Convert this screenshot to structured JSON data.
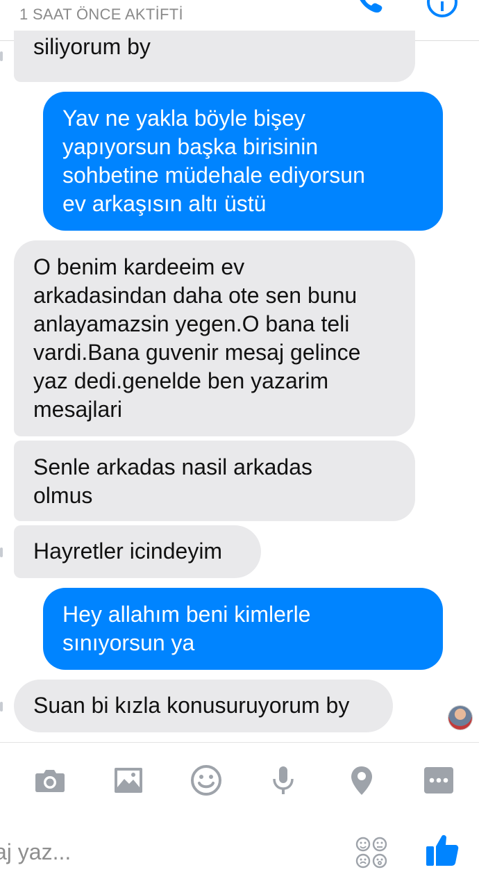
{
  "header": {
    "status": "1 SAAT ÖNCE AKTİFTİ",
    "icons": [
      "phone-icon",
      "info-icon"
    ]
  },
  "colors": {
    "outgoing": "#0084ff",
    "incoming": "#e9e9eb",
    "icon_gray": "#9ea3aa",
    "like_blue": "#0084ff"
  },
  "messages": [
    {
      "direction": "in",
      "lines": [
        "siliyorum by"
      ]
    },
    {
      "direction": "out",
      "lines": [
        "Yav ne yakla böyle bişey",
        "yapıyorsun başka birisinin",
        "sohbetine müdehale ediyorsun",
        "ev arkaşısın altı üstü"
      ]
    },
    {
      "direction": "in",
      "lines": [
        "O benim kardeeim ev",
        "arkadasindan daha ote sen bunu",
        "anlayamazsin yegen.O bana teli",
        "vardi.Bana guvenir mesaj gelince",
        "yaz dedi.genelde ben yazarim",
        "mesajlari"
      ]
    },
    {
      "direction": "in",
      "lines": [
        "Senle arkadas nasil arkadas",
        "olmus"
      ]
    },
    {
      "direction": "in",
      "lines": [
        "Hayretler icindeyim"
      ]
    },
    {
      "direction": "out",
      "lines": [
        "Hey allahım beni kimlerle",
        "sınıyorsun ya"
      ]
    },
    {
      "direction": "in",
      "lines": [
        "Suan bi kızla konusuruyorum by"
      ]
    }
  ],
  "toolbar": {
    "icons": [
      "camera-icon",
      "gallery-icon",
      "emoji-icon",
      "microphone-icon",
      "location-icon",
      "more-icon"
    ]
  },
  "composer": {
    "placeholder": "aj yaz...",
    "icons": [
      "sticker-icon",
      "like-icon"
    ]
  }
}
